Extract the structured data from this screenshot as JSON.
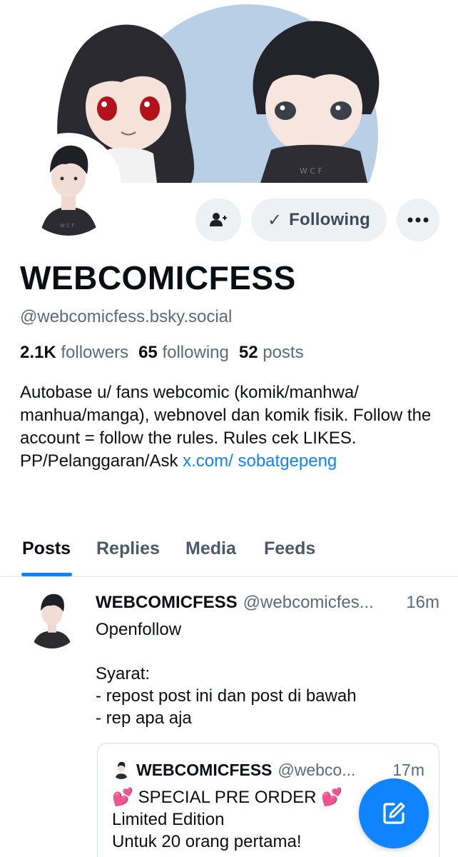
{
  "profile": {
    "display_name": "WEBCOMICFESS",
    "handle": "@webcomicfess.bsky.social",
    "stats": {
      "followers_count": "2.1K",
      "followers_label": "followers",
      "following_count": "65",
      "following_label": "following",
      "posts_count": "52",
      "posts_label": "posts"
    },
    "bio_text": "Autobase u/ fans webcomic (komik/manhwa/ manhua/manga), webnovel dan komik fisik. Follow the account = follow the rules. Rules cek LIKES. PP/Pelanggaran/Ask ",
    "bio_link": "x.com/ sobatgepeng"
  },
  "actions": {
    "add_user_icon": "person-plus-icon",
    "following_check": "✓",
    "following_label": "Following",
    "more_icon": "ellipsis-icon"
  },
  "tabs": [
    {
      "label": "Posts",
      "active": true
    },
    {
      "label": "Replies",
      "active": false
    },
    {
      "label": "Media",
      "active": false
    },
    {
      "label": "Feeds",
      "active": false
    }
  ],
  "post": {
    "author_name": "WEBCOMICFESS",
    "author_handle": "@webcomicfes...",
    "time": "16m",
    "text": "Openfollow\n\nSyarat:\n- repost post ini dan post di bawah\n- rep apa aja",
    "quote": {
      "author_name": "WEBCOMICFESS",
      "author_handle": "@webco...",
      "time": "17m",
      "line1": "SPECIAL PRE ORDER",
      "line2": "Limited Edition",
      "line3": "Untuk 20 orang pertama!",
      "emoji": "💕"
    }
  },
  "fab": {
    "icon": "compose-icon"
  },
  "colors": {
    "accent": "#1083fe",
    "muted_text": "#5b6a7c",
    "button_bg": "#eef1f4",
    "banner_bg": "#b9cfe6"
  }
}
